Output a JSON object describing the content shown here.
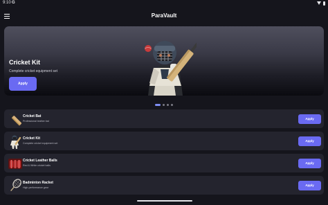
{
  "status_bar": {
    "time": "9:10",
    "g_badge": "G",
    "icons": [
      "wifi-icon",
      "battery-icon"
    ]
  },
  "app_bar": {
    "title": "ParaVault",
    "menu_icon": "menu-icon"
  },
  "hero": {
    "title": "Cricket Kit",
    "subtitle": "Complete cricket equipment set",
    "button_label": "Apply",
    "illustration": "cricket-batsman-illustration"
  },
  "carousel": {
    "dot_count": 4,
    "active_index": 0
  },
  "products": [
    {
      "name": "Cricket Bat",
      "description": "Professional leather bat",
      "button_label": "Apply",
      "icon": "cricket-bat-icon"
    },
    {
      "name": "Cricket Kit",
      "description": "Complete cricket equipment set",
      "button_label": "Apply",
      "icon": "cricket-player-icon"
    },
    {
      "name": "Cricket Leather Balls",
      "description": "Red & White cricket balls",
      "button_label": "Apply",
      "icon": "cricket-balls-icon"
    },
    {
      "name": "Badminton Racket",
      "description": "High-performance gear",
      "button_label": "Apply",
      "icon": "badminton-racket-icon"
    }
  ],
  "colors": {
    "background": "#15151c",
    "card": "#24242e",
    "accent": "#6a6af2",
    "active_dot": "#7e8df2"
  }
}
